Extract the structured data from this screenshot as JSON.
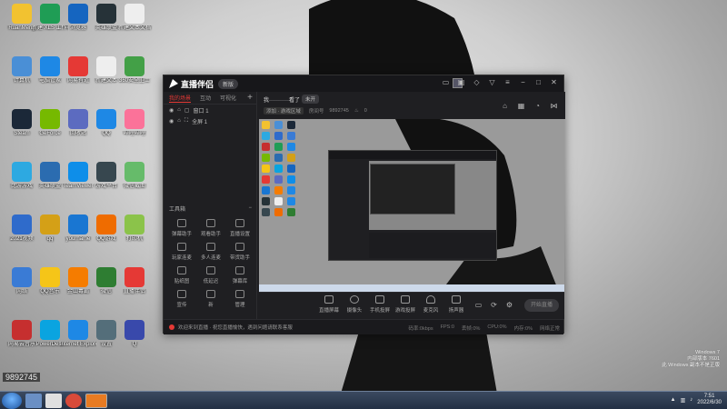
{
  "desktop": {
    "icons": [
      {
        "label": "RuanMeng",
        "color": "#f2c230"
      },
      {
        "label": "计算机",
        "color": "#4a8fd6"
      },
      {
        "label": "Steam",
        "color": "#1b2838"
      },
      {
        "label": "比游游戏",
        "color": "#2da9e1"
      },
      {
        "label": "2021视频",
        "color": "#2f6bcb"
      },
      {
        "label": "网络",
        "color": "#3a7bd5"
      },
      {
        "label": "网易云音乐",
        "color": "#c62f2f"
      },
      {
        "label": "新建 XLS 工作表",
        "color": "#1f9d55"
      },
      {
        "label": "电脑管家",
        "color": "#1e88e5"
      },
      {
        "label": "GeForce",
        "color": "#76b900"
      },
      {
        "label": "英雄联盟",
        "color": "#2b6cb0"
      },
      {
        "label": "qq",
        "color": "#d4a017"
      },
      {
        "label": "QQ音乐",
        "color": "#f5c518"
      },
      {
        "label": "PowerDesk",
        "color": "#0aa4e0"
      },
      {
        "label": "浏览器",
        "color": "#1565c0"
      },
      {
        "label": "网易有道",
        "color": "#e53935"
      },
      {
        "label": "回收站",
        "color": "#5c6bc0"
      },
      {
        "label": "TeamViewer",
        "color": "#0e8ee9"
      },
      {
        "label": "yourname",
        "color": "#1976d2"
      },
      {
        "label": "金山毒霸",
        "color": "#f57c00"
      },
      {
        "label": "Internet Explorer",
        "color": "#1e88e5"
      },
      {
        "label": "英雄联盟",
        "color": "#263238"
      },
      {
        "label": "新建文本",
        "color": "#eeeeee"
      },
      {
        "label": "QQ",
        "color": "#1e88e5"
      },
      {
        "label": "游戏平台",
        "color": "#37474f"
      },
      {
        "label": "QQ游戏",
        "color": "#ef6c00"
      },
      {
        "label": "微信",
        "color": "#2e7d32"
      },
      {
        "label": "设置",
        "color": "#546e7a"
      },
      {
        "label": "新建文本文档",
        "color": "#eeeeee"
      },
      {
        "label": "360安全卫士",
        "color": "#43a047"
      },
      {
        "label": "哔哩哔哩",
        "color": "#fb7299"
      },
      {
        "label": "微信截图",
        "color": "#66bb6a"
      },
      {
        "label": "打印机",
        "color": "#8bc34a"
      },
      {
        "label": "直播伴侣",
        "color": "#e53935"
      },
      {
        "label": "Q",
        "color": "#3949ab"
      }
    ]
  },
  "overlay_id": "9892745",
  "watermark": {
    "line1": "Windows 7",
    "line2": "内部版本 7601",
    "line3": "此 Windows 副本不是正版"
  },
  "app": {
    "name": "直播伴侣",
    "version": "新版",
    "tabs": [
      "我的场景",
      "互动",
      "可视化"
    ],
    "tab_add": "+",
    "scenes": [
      "窗口 1",
      "全屏 1"
    ],
    "toolbox_label": "工具箱",
    "toolbox_toggle": "−",
    "tools": [
      "弹幕助手",
      "观看助手",
      "直播设置",
      "玩家连麦",
      "多人连麦",
      "带货助手",
      "贴纸图",
      "低延迟",
      "弹幕库",
      "宣传",
      "新",
      "管理"
    ],
    "streamer_name": "我···········看了",
    "stream_status": "未开",
    "category": "添加 · 游戏区域",
    "room_label": "房间号",
    "room_id": "9892745",
    "heat": "0",
    "controls": [
      "直播屏幕",
      "摄像头",
      "手机投屏",
      "游戏投屏",
      "麦克风",
      "扬声器"
    ],
    "live_button": "开始直播",
    "notice": "欢迎来到直播 · 祝您直播愉快，遇到问题请联系客服",
    "stats": [
      "码率:0kbps",
      "FPS:0",
      "丢帧:0%",
      "CPU:0%",
      "内存:0%",
      "网络正常"
    ]
  },
  "taskbar": {
    "clock_time": "7:51",
    "clock_date": "2022/6/30"
  }
}
